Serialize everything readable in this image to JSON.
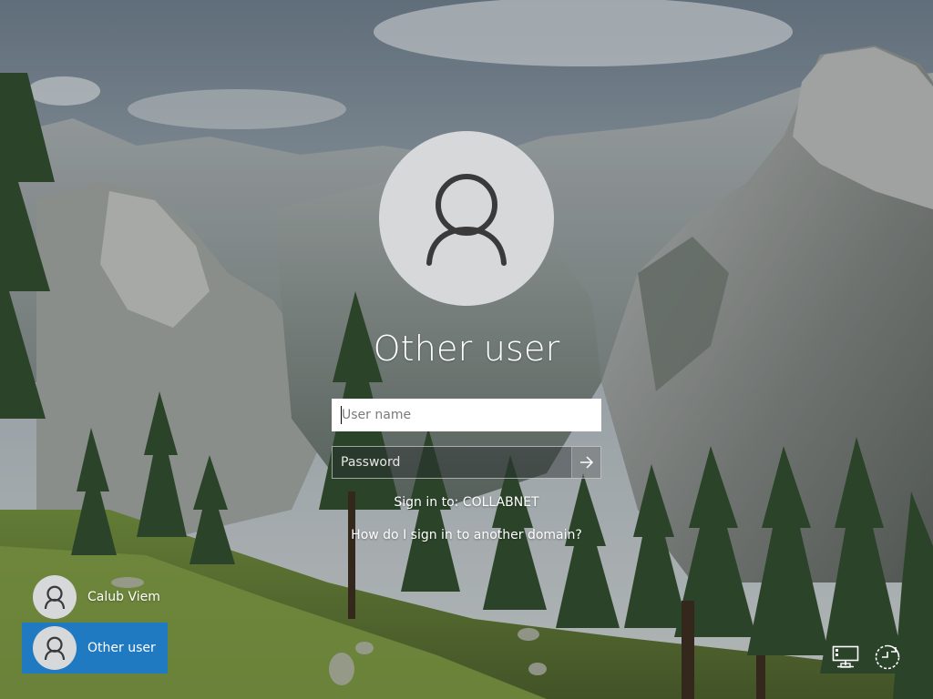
{
  "selected_user": {
    "title": "Other user",
    "avatar_icon": "user-silhouette-icon"
  },
  "form": {
    "username_placeholder": "User name",
    "username_value": "",
    "password_placeholder": "Password",
    "password_value": "",
    "submit_icon": "arrow-right-icon",
    "sign_in_to": "Sign in to: COLLABNET",
    "domain_help_link": "How do I sign in to another domain?"
  },
  "user_tiles": [
    {
      "label": "Calub Viem",
      "avatar_icon": "user-silhouette-icon",
      "selected": false
    },
    {
      "label": "Other user",
      "avatar_icon": "user-silhouette-icon",
      "selected": true
    }
  ],
  "system_buttons": [
    {
      "icon": "network-icon"
    },
    {
      "icon": "ease-of-access-icon"
    }
  ],
  "colors": {
    "accent": "#1f7ac2",
    "avatar_bg": "#d6d8da",
    "avatar_glyph": "#3a3a3a",
    "text": "#ffffff"
  }
}
